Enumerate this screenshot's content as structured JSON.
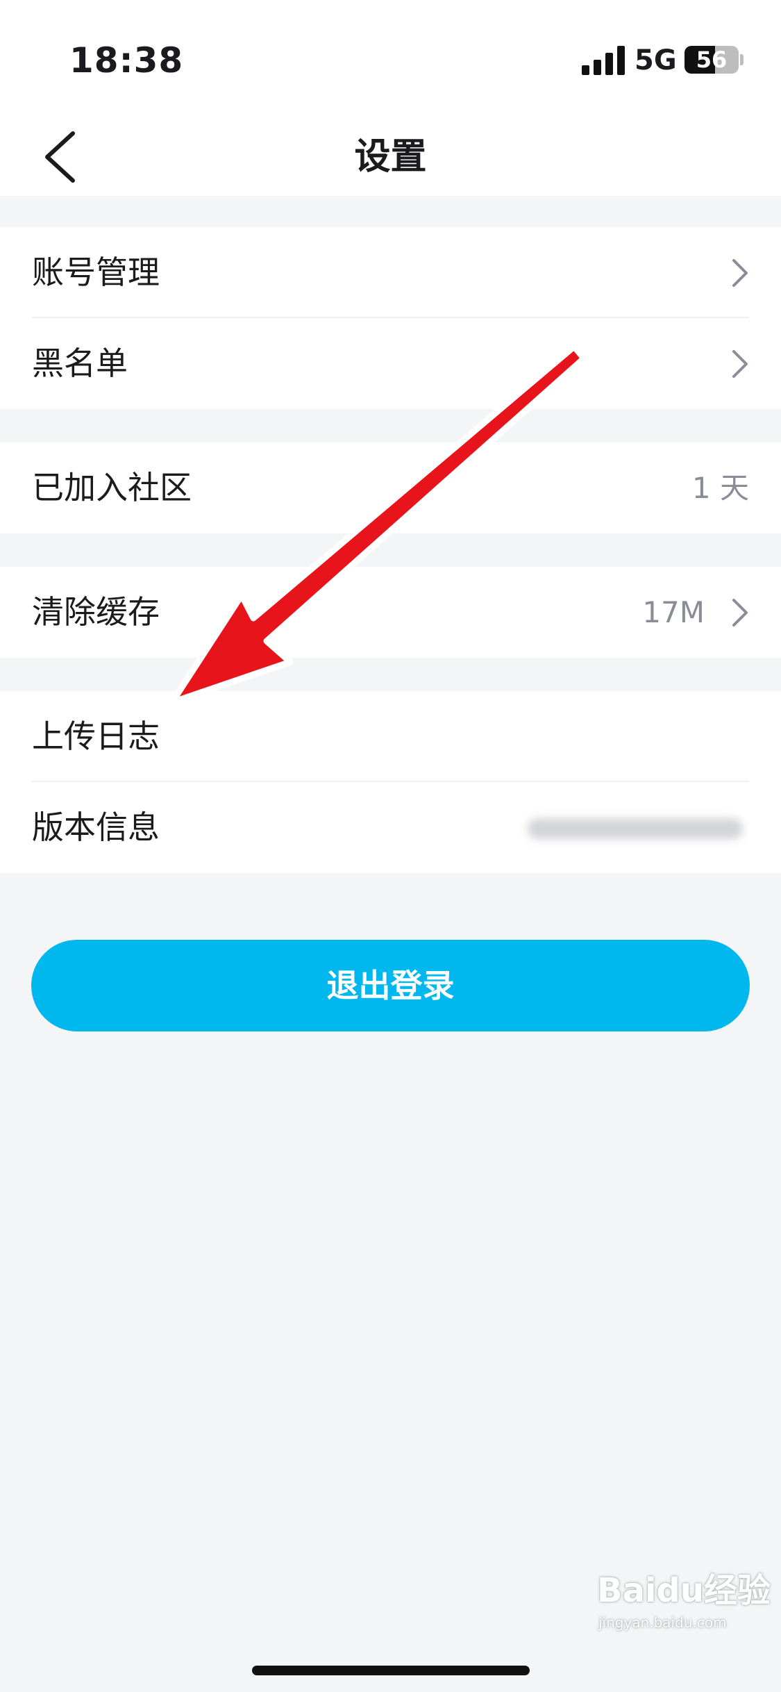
{
  "status_bar": {
    "time": "18:38",
    "network": "5G",
    "battery": 56,
    "battery_label": "56"
  },
  "header": {
    "title": "设置"
  },
  "groups": [
    [
      {
        "label": "账号管理",
        "value": "",
        "chevron": true
      },
      {
        "label": "黑名单",
        "value": "",
        "chevron": true
      }
    ],
    [
      {
        "label": "已加入社区",
        "value": "1 天",
        "chevron": false
      }
    ],
    [
      {
        "label": "清除缓存",
        "value": "17M",
        "chevron": true
      }
    ],
    [
      {
        "label": "上传日志",
        "value": "",
        "chevron": false
      },
      {
        "label": "版本信息",
        "value": "",
        "chevron": false
      }
    ]
  ],
  "logout_label": "退出登录",
  "watermark": {
    "brand": "Baidu经验",
    "url": "jingyan.baidu.com"
  },
  "colors": {
    "accent": "#00b7ee",
    "arrow": "#e8141b",
    "background": "#f4f5f7"
  }
}
